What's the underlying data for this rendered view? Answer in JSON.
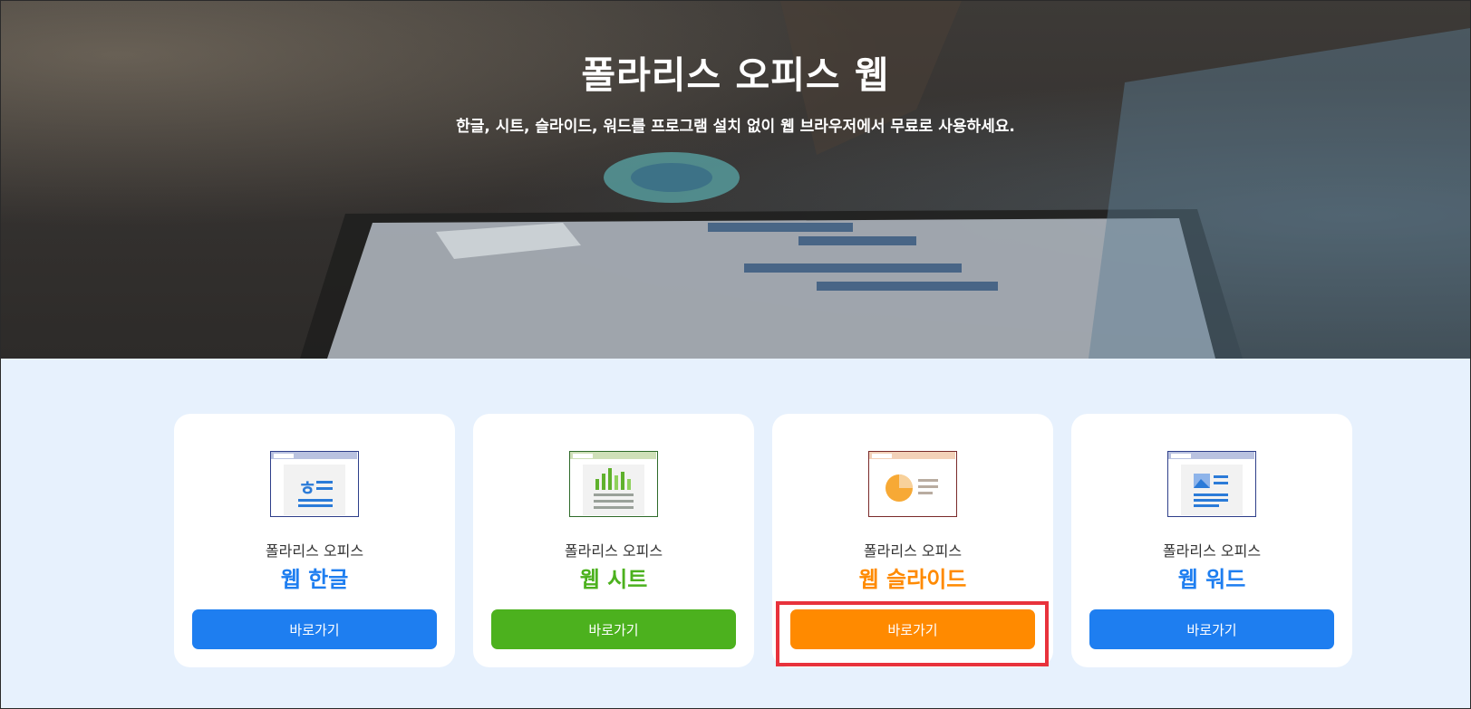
{
  "hero": {
    "title": "폴라리스 오피스 웹",
    "subtitle": "한글, 시트, 슬라이드, 워드를 프로그램 설치 없이 웹 브라우저에서 무료로 사용하세요."
  },
  "cards": [
    {
      "caption": "폴라리스 오피스",
      "name": "웹 한글",
      "button": "바로가기",
      "accent": "#1e7ef0",
      "icon": "hangul-doc-icon"
    },
    {
      "caption": "폴라리스 오피스",
      "name": "웹 시트",
      "button": "바로가기",
      "accent": "#4cb11e",
      "icon": "sheet-chart-icon"
    },
    {
      "caption": "폴라리스 오피스",
      "name": "웹 슬라이드",
      "button": "바로가기",
      "accent": "#ff8a00",
      "icon": "slide-pie-icon"
    },
    {
      "caption": "폴라리스 오피스",
      "name": "웹 워드",
      "button": "바로가기",
      "accent": "#1e7ef0",
      "icon": "word-doc-icon"
    }
  ],
  "colors": {
    "background": "#e7f1fd",
    "highlight": "#e8323c"
  }
}
